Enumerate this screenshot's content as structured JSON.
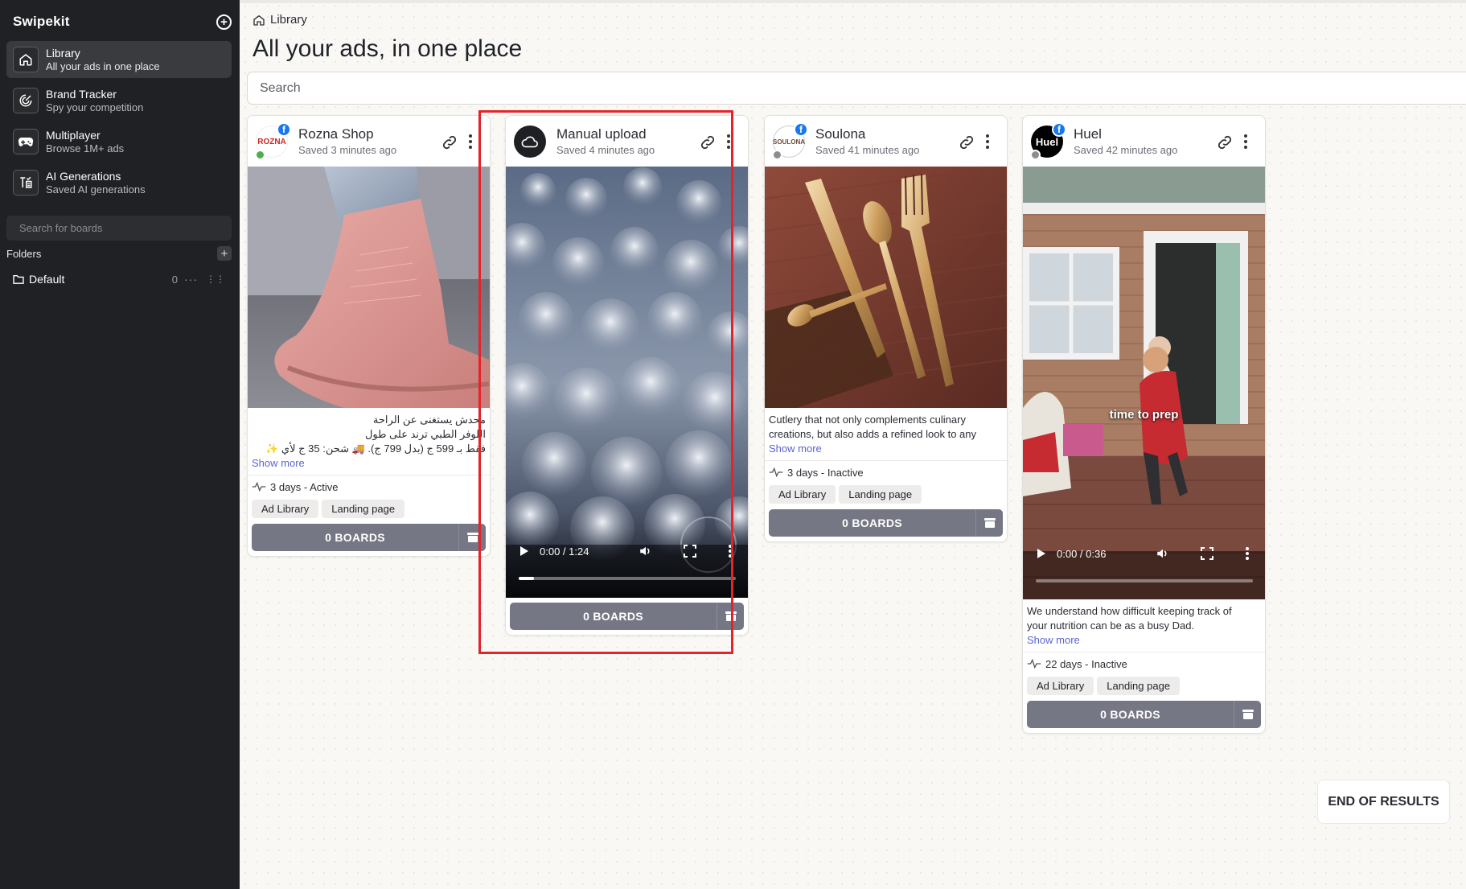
{
  "app": {
    "name": "Swipekit"
  },
  "sidebar": {
    "items": [
      {
        "title": "Library",
        "subtitle": "All your ads in one place",
        "icon": "home-icon"
      },
      {
        "title": "Brand Tracker",
        "subtitle": "Spy your competition",
        "icon": "target-icon"
      },
      {
        "title": "Multiplayer",
        "subtitle": "Browse 1M+ ads",
        "icon": "gamepad-icon"
      },
      {
        "title": "AI Generations",
        "subtitle": "Saved AI generations",
        "icon": "ai-text-icon"
      }
    ],
    "board_search_placeholder": "Search for boards",
    "folders_label": "Folders",
    "folders": [
      {
        "name": "Default",
        "count": "0"
      }
    ]
  },
  "header": {
    "breadcrumb": "Library",
    "title": "All your ads, in one place",
    "search_placeholder": "Search"
  },
  "cards": [
    {
      "brand": "Rozna Shop",
      "saved": "Saved 3 minutes ago",
      "avatar_text": "ROZNA",
      "status_color": "#4caf50",
      "caption_lines": [
        "محدش يستغنى عن الراحة",
        "اللوفر الطبي ترند على طول",
        "فقط بـ 599 ج (بدل 799 ج). 🚚 شحن: 35 ج لأي ✨"
      ],
      "show_more": "Show more",
      "metric": "3 days - Active",
      "tags": [
        "Ad Library",
        "Landing page"
      ],
      "boards_label": "0 BOARDS"
    },
    {
      "brand": "Manual upload",
      "saved": "Saved 4 minutes ago",
      "video_time": "0:00 / 1:24",
      "video_progress": 0.07,
      "boards_label": "0 BOARDS"
    },
    {
      "brand": "Soulona",
      "saved": "Saved 41 minutes ago",
      "avatar_text": "SOULONA",
      "status_color": "#8d8d8d",
      "caption_lines": [
        "Cutlery that not only complements culinary",
        "creations, but also adds a refined look to any"
      ],
      "show_more": "Show more",
      "metric": "3 days - Inactive",
      "tags": [
        "Ad Library",
        "Landing page"
      ],
      "boards_label": "0 BOARDS"
    },
    {
      "brand": "Huel",
      "saved": "Saved 42 minutes ago",
      "avatar_text": "Huel",
      "status_color": "#8d8d8d",
      "overlay_text": "time to prep",
      "video_time": "0:00 / 0:36",
      "video_progress": 0.0,
      "caption_lines": [
        "We understand how difficult keeping track of",
        "your nutrition can be as a busy Dad."
      ],
      "show_more": "Show more",
      "metric": "22 days - Inactive",
      "tags": [
        "Ad Library",
        "Landing page"
      ],
      "boards_label": "0 BOARDS"
    }
  ],
  "end_of_results": "END OF RESULTS",
  "colors": {
    "sidebar_bg": "#202124",
    "accent_link": "#5b63d3",
    "boards_button": "#767784",
    "highlight": "#e3242b",
    "facebook": "#1877f2"
  }
}
